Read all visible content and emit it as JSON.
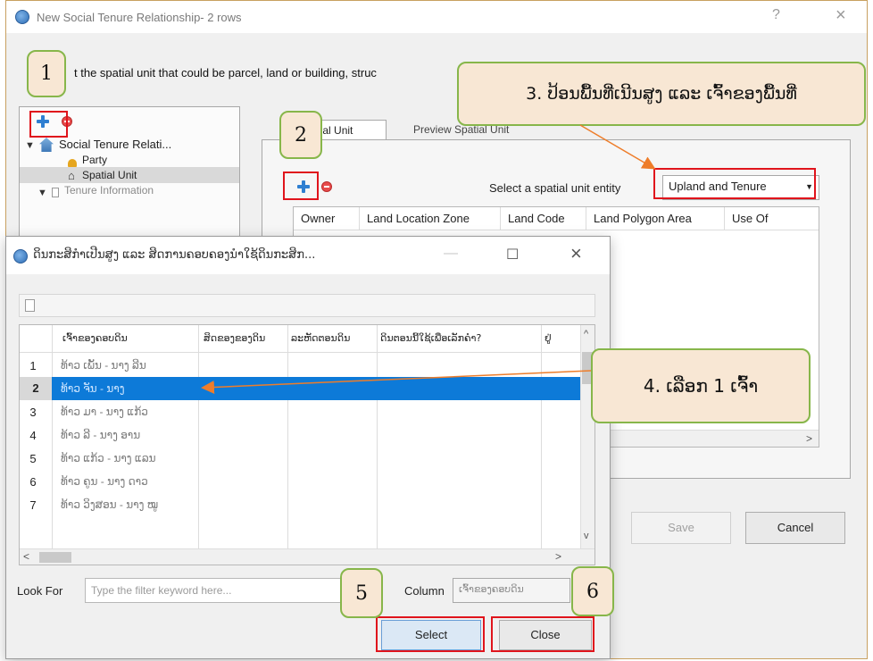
{
  "main_window": {
    "title": "New Social Tenure Relationship- 2 rows",
    "help_glyph": "?",
    "close_glyph": "×",
    "instruction": "t the spatial unit that could be parcel, land or building, struc",
    "tree": {
      "root": "Social Tenure Relati...",
      "items": [
        "Party",
        "Spatial Unit",
        "Tenure Information"
      ]
    },
    "tabs": [
      {
        "label": "Spatial Unit",
        "state": "active"
      },
      {
        "label": "Preview Spatial Unit",
        "state": "inactive"
      }
    ],
    "select_entity_label": "Select a spatial unit entity",
    "select_entity_value": "Upland and Tenure",
    "columns": [
      "Owner",
      "Land Location Zone",
      "Land Code",
      "Land Polygon Area",
      "Use Of"
    ],
    "save_label": "Save",
    "cancel_label": "Cancel",
    "scroll_right_glyph": ">"
  },
  "overlay_window": {
    "title": "ດິນກະສິກຳເປີນສູງ ແລະ ສິດການຄອບຄອງນຳໃຊ້ດິນກະສິກ...",
    "minimize_glyph": "—",
    "maximize_glyph": "☐",
    "close_glyph": "×",
    "columns": [
      "ເຈົ້າຂອງຄອບດິນ",
      "ສິດຂອງຂອງດິນ",
      "ລະຫັດຕອນດິນ",
      "ດິນຕອນນີ້ໃຊ້ເພື່ອເລັກຄຳ?",
      "ຢູ່"
    ],
    "rows": [
      {
        "num": "1",
        "owner": "ທ້າວ ເພັ້ນ - ນາງ ລີນ",
        "selected": false
      },
      {
        "num": "2",
        "owner": "ທ້າວ ຈັນ - ນາງ",
        "selected": true
      },
      {
        "num": "3",
        "owner": "ທ້າວ ມາ - ນາງ ແກ້ວ",
        "selected": false
      },
      {
        "num": "4",
        "owner": "ທ້າວ ລີ - ນາງ ອານ",
        "selected": false
      },
      {
        "num": "5",
        "owner": "ທ້າວ ແກ້ວ - ນາງ ແລນ",
        "selected": false
      },
      {
        "num": "6",
        "owner": "ທ້າວ ຄູນ - ນາງ ດາວ",
        "selected": false
      },
      {
        "num": "7",
        "owner": "ທ້າວ ວິງສອນ - ນາງ ໝູ",
        "selected": false
      }
    ],
    "look_for_label": "Look For",
    "filter_placeholder": "Type the filter keyword here...",
    "column_label": "Column",
    "column_value": "ເຈົ້າຂອງຄອບດິນ",
    "select_label": "Select",
    "close_label": "Close",
    "scroll_up_glyph": "^",
    "scroll_down_glyph": "v",
    "scroll_left_glyph": "<",
    "scroll_right_glyph": ">"
  },
  "annotations": {
    "step1": "1",
    "step2": "2",
    "step3": "3. ປ້ອນພື້ນທີ່ເນີນສູງ ແລະ ເຈົ້າຂອງພື້ນທີ່",
    "step4": "4. ເລືອກ 1 ເຈົ້າ",
    "step5": "5",
    "step6": "6"
  },
  "colors": {
    "annotation_fill": "#f8e7d4",
    "annotation_border": "#87b64a",
    "highlight_red": "#e0141c",
    "arrow_orange": "#ee7d2a",
    "selection_blue": "#0d7ad8"
  }
}
